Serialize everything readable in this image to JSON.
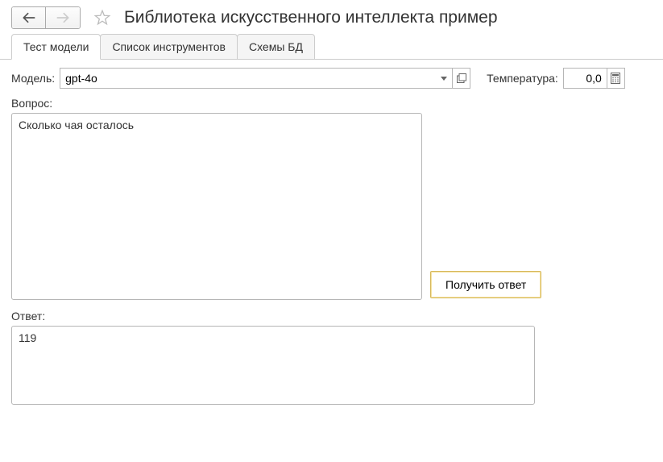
{
  "header": {
    "title": "Библиотека искусственного интеллекта пример"
  },
  "tabs": [
    {
      "label": "Тест модели",
      "active": true
    },
    {
      "label": "Список инструментов",
      "active": false
    },
    {
      "label": "Схемы БД",
      "active": false
    }
  ],
  "form": {
    "model_label": "Модель:",
    "model_value": "gpt-4o",
    "temperature_label": "Температура:",
    "temperature_value": "0,0",
    "question_label": "Вопрос:",
    "question_value": "Сколько чая осталось",
    "get_answer_label": "Получить ответ",
    "answer_label": "Ответ:",
    "answer_value": "119"
  }
}
